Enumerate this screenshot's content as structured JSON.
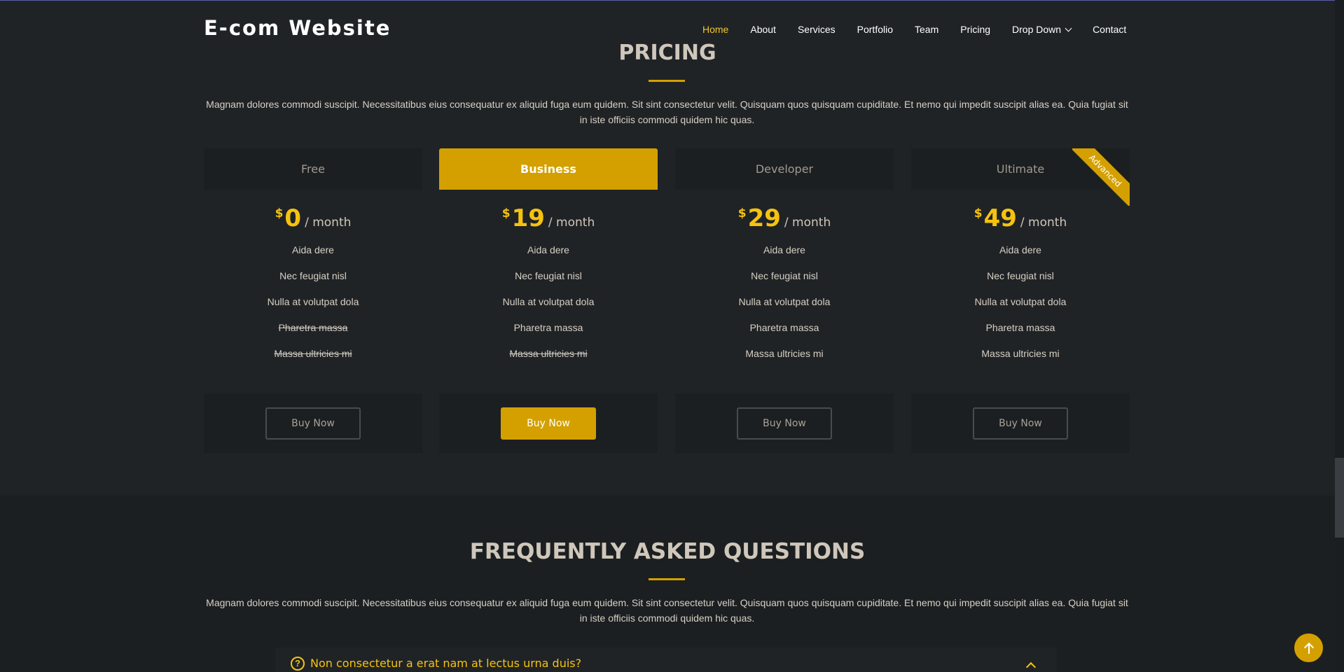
{
  "header": {
    "logo": "E-com Website",
    "nav": [
      {
        "label": "Home",
        "active": true
      },
      {
        "label": "About"
      },
      {
        "label": "Services"
      },
      {
        "label": "Portfolio"
      },
      {
        "label": "Team"
      },
      {
        "label": "Pricing"
      },
      {
        "label": "Drop Down",
        "has_dropdown": true
      },
      {
        "label": "Contact"
      }
    ]
  },
  "pricing": {
    "title": "PRICING",
    "description": "Magnam dolores commodi suscipit. Necessitatibus eius consequatur ex aliquid fuga eum quidem. Sit sint consectetur velit. Quisquam quos quisquam cupiditate. Et nemo qui impedit suscipit alias ea. Quia fugiat sit in iste officiis commodi quidem hic quas.",
    "plans": [
      {
        "name": "Free",
        "currency": "$",
        "price": "0",
        "period": "/ month",
        "features": [
          {
            "text": "Aida dere",
            "available": true
          },
          {
            "text": "Nec feugiat nisl",
            "available": true
          },
          {
            "text": "Nulla at volutpat dola",
            "available": true
          },
          {
            "text": "Pharetra massa",
            "available": false
          },
          {
            "text": "Massa ultricies mi",
            "available": false
          }
        ],
        "button": "Buy Now"
      },
      {
        "name": "Business",
        "currency": "$",
        "price": "19",
        "period": "/ month",
        "featured": true,
        "features": [
          {
            "text": "Aida dere",
            "available": true
          },
          {
            "text": "Nec feugiat nisl",
            "available": true
          },
          {
            "text": "Nulla at volutpat dola",
            "available": true
          },
          {
            "text": "Pharetra massa",
            "available": true
          },
          {
            "text": "Massa ultricies mi",
            "available": false
          }
        ],
        "button": "Buy Now"
      },
      {
        "name": "Developer",
        "currency": "$",
        "price": "29",
        "period": "/ month",
        "features": [
          {
            "text": "Aida dere",
            "available": true
          },
          {
            "text": "Nec feugiat nisl",
            "available": true
          },
          {
            "text": "Nulla at volutpat dola",
            "available": true
          },
          {
            "text": "Pharetra massa",
            "available": true
          },
          {
            "text": "Massa ultricies mi",
            "available": true
          }
        ],
        "button": "Buy Now"
      },
      {
        "name": "Ultimate",
        "currency": "$",
        "price": "49",
        "period": "/ month",
        "ribbon": "Advanced",
        "features": [
          {
            "text": "Aida dere",
            "available": true
          },
          {
            "text": "Nec feugiat nisl",
            "available": true
          },
          {
            "text": "Nulla at volutpat dola",
            "available": true
          },
          {
            "text": "Pharetra massa",
            "available": true
          },
          {
            "text": "Massa ultricies mi",
            "available": true
          }
        ],
        "button": "Buy Now"
      }
    ]
  },
  "faq": {
    "title": "FREQUENTLY ASKED QUESTIONS",
    "description": "Magnam dolores commodi suscipit. Necessitatibus eius consequatur ex aliquid fuga eum quidem. Sit sint consectetur velit. Quisquam quos quisquam cupiditate. Et nemo qui impedit suscipit alias ea. Quia fugiat sit in iste officiis commodi quidem hic quas.",
    "items": [
      {
        "question": "Non consectetur a erat nam at lectus urna duis?",
        "icon": "question-circle-icon",
        "expanded": true
      }
    ]
  },
  "colors": {
    "accent": "#d4a000",
    "price": "#f5c30f",
    "background": "#202326",
    "panel": "#1c1f21"
  }
}
